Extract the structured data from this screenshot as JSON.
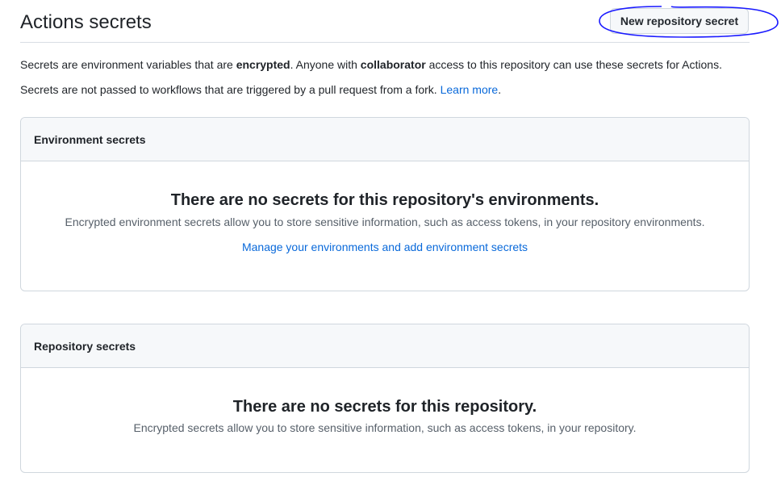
{
  "header": {
    "title": "Actions secrets",
    "new_secret_button": "New repository secret",
    "annotation_color": "#1a1aff"
  },
  "description": {
    "line1_before": "Secrets are environment variables that are ",
    "line1_bold1": "encrypted",
    "line1_middle": ". Anyone with ",
    "line1_bold2": "collaborator",
    "line1_after": " access to this repository can use these secrets for Actions.",
    "line2_text": "Secrets are not passed to workflows that are triggered by a pull request from a fork. ",
    "line2_link": "Learn more",
    "line2_end": "."
  },
  "environment_secrets": {
    "heading": "Environment secrets",
    "blank_title": "There are no secrets for this repository's environments.",
    "blank_text": "Encrypted environment secrets allow you to store sensitive information, such as access tokens, in your repository environments.",
    "manage_link": "Manage your environments and add environment secrets"
  },
  "repository_secrets": {
    "heading": "Repository secrets",
    "blank_title": "There are no secrets for this repository.",
    "blank_text": "Encrypted secrets allow you to store sensitive information, such as access tokens, in your repository."
  },
  "colors": {
    "link": "#0969da",
    "border": "#d0d7de",
    "box_header_bg": "#f6f8fa",
    "muted_text": "#57606a"
  }
}
